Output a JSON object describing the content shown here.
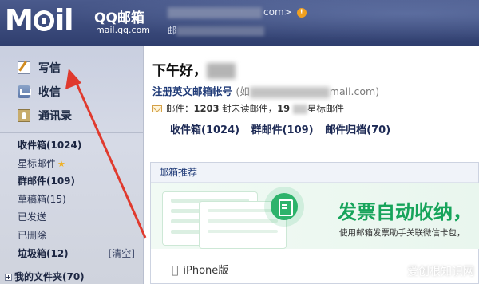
{
  "header": {
    "logo_text": "M",
    "logo_text_tail": "il",
    "brand": "QQ邮箱",
    "domain": "mail.qq.com",
    "user_email_suffix": "com>",
    "alert_icon": "!",
    "user_sub_prefix": "邮"
  },
  "sidebar": {
    "compose_label": "写信",
    "inbox_label": "收信",
    "contacts_label": "通讯录",
    "folders": [
      {
        "label": "收件箱(1024)"
      },
      {
        "label": "星标邮件"
      },
      {
        "label": "群邮件(109)"
      },
      {
        "label": "草稿箱(15)"
      },
      {
        "label": "已发送"
      },
      {
        "label": "已删除"
      },
      {
        "label": "垃圾箱(12)"
      }
    ],
    "clear_label": "[清空]",
    "my_folders_label": "我的文件夹(70)"
  },
  "main": {
    "greeting": "下午好，",
    "register_label": "注册英文邮箱帐号",
    "register_paren_open": "(如",
    "register_email_tail": "mail.com)",
    "mail_info_prefix": "邮件：",
    "mail_unread": "1203",
    "mail_unread_suffix": "封未读邮件，",
    "mail_star": "19",
    "mail_star_suffix": "星标邮件",
    "quick_links": [
      "收件箱(1024)",
      "群邮件(109)",
      "邮件归档(70)"
    ],
    "panel_title": "邮箱推荐",
    "banner_title": "发票自动收纳，",
    "banner_subtitle": "使用邮箱发票助手关联微信卡包，",
    "iphone_label": "iPhone版"
  },
  "watermark": "爱创根知识网",
  "colors": {
    "header_bg": "#2f3e6e",
    "sidebar_bg": "#cfd3dd",
    "link_blue": "#1f3a77",
    "banner_green": "#17a45b",
    "arrow_red": "#e03a2e"
  }
}
